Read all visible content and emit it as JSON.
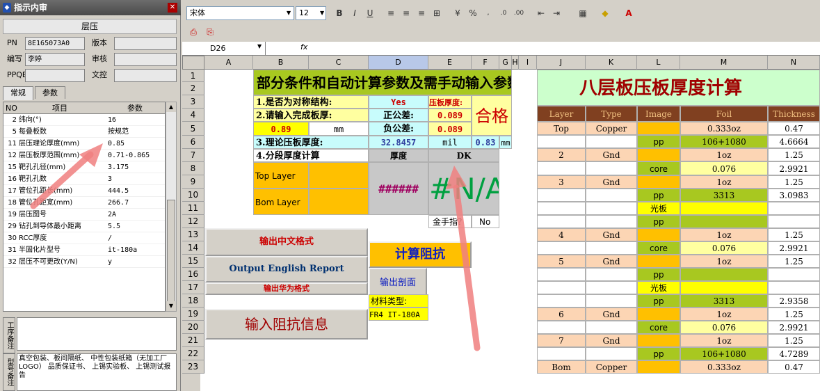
{
  "panel": {
    "title": "指示内审",
    "section": "层压",
    "fields": [
      {
        "label": "PN",
        "value": "8E165073A0"
      },
      {
        "label": "版本",
        "value": ""
      },
      {
        "label": "编写",
        "value": "李婷"
      },
      {
        "label": "审核",
        "value": ""
      },
      {
        "label": "PPQE",
        "value": ""
      },
      {
        "label": "文控",
        "value": ""
      }
    ],
    "tabs": [
      "常规",
      "参数"
    ],
    "grid_headers": [
      "NO",
      "项目",
      "参数"
    ],
    "rows": [
      [
        "2",
        "纬向(°)",
        "16"
      ],
      [
        "5",
        "每叠板数",
        "按规范"
      ],
      [
        "11",
        "层压理论厚度(mm)",
        "0.85"
      ],
      [
        "12",
        "层压板厚范围(mm)",
        "0.71-0.865"
      ],
      [
        "15",
        "靶孔孔径(mm)",
        "3.175"
      ],
      [
        "16",
        "靶孔孔数",
        "3"
      ],
      [
        "17",
        "管位孔距长(mm)",
        "444.5"
      ],
      [
        "18",
        "管位孔距宽(mm)",
        "266.7"
      ],
      [
        "19",
        "层压图号",
        "2A"
      ],
      [
        "29",
        "钻孔到导体最小距离",
        "5.5"
      ],
      [
        "30",
        "RCC厚度",
        "/"
      ],
      [
        "31",
        "半固化片型号",
        "it-180a"
      ],
      [
        "32",
        "层压不可更改(Y/N)",
        "y"
      ]
    ],
    "note1_label": "工序备注",
    "note2_label": "型号备注",
    "note2_text": "真空包装、板间隔纸、 中性包装纸箱（无加工厂LOGO） 品质保证书、 上锡实验板、 上锡测试报告"
  },
  "toolbar": {
    "font": "宋体",
    "size": "12",
    "bold": "B",
    "italic": "I",
    "underline": "U"
  },
  "formula": {
    "cellref": "D26",
    "fx": "fx"
  },
  "sheet": {
    "cols": [
      "A",
      "B",
      "C",
      "D",
      "E",
      "F",
      "G",
      "H",
      "I",
      "J",
      "K",
      "L",
      "M",
      "N"
    ],
    "rows": [
      "1",
      "2",
      "3",
      "4",
      "5",
      "6",
      "7",
      "8",
      "9",
      "10",
      "11",
      "12",
      "13",
      "14",
      "15",
      "16",
      "17",
      "18",
      "19",
      "20",
      "21",
      "22",
      "23"
    ],
    "title": "部分条件和自动计算参数及需手动输入参数",
    "r3a": "1.是否为对称结构:",
    "r3c": "Yes",
    "r3d": "压板厚度:",
    "r4a": "2.请输入完成板厚:",
    "r4c": "正公差:",
    "r4d": "0.089",
    "r5a": "0.89",
    "r5b": "mm",
    "r5c": "负公差:",
    "r5d": "0.089",
    "result": "合格",
    "r6a": "3.理论压板厚度:",
    "r6c": "32.8457",
    "r6d": "mil",
    "r6e": "0.83",
    "r6f": "mm",
    "r7a": "4.分段厚度计算",
    "r7c": "厚度",
    "r7d": "DK",
    "top_layer": "Top Layer",
    "bom_layer": "Bom Layer",
    "hash": "######",
    "na": "#N/A",
    "btn_cn": "输出中文格式",
    "btn_en": "Output English Report",
    "btn_hw": "输出华为格式",
    "btn_imp": "输入阻抗信息",
    "gold_label": "金手指？",
    "gold_val": "No",
    "btn_calc": "计算阻抗",
    "btn_sec": "输出剖面",
    "mat_label": "材料类型:",
    "mat_val": "FR4 IT-180A",
    "right_title": "八层板压板厚度计算",
    "stack_headers": [
      "Layer",
      "Type",
      "Image",
      "Foil",
      "Thickness"
    ],
    "stack": [
      [
        "Top",
        "Copper",
        "",
        "0.333oz",
        "0.47"
      ],
      [
        "",
        "",
        "pp",
        "106+1080",
        "4.6664"
      ],
      [
        "2",
        "Gnd",
        "",
        "1oz",
        "1.25"
      ],
      [
        "",
        "",
        "core",
        "0.076",
        "2.9921"
      ],
      [
        "3",
        "Gnd",
        "",
        "1oz",
        "1.25"
      ],
      [
        "",
        "",
        "pp",
        "3313",
        "3.0983"
      ],
      [
        "",
        "",
        "光板",
        "",
        ""
      ],
      [
        "",
        "",
        "pp",
        "",
        ""
      ],
      [
        "4",
        "Gnd",
        "",
        "1oz",
        "1.25"
      ],
      [
        "",
        "",
        "core",
        "0.076",
        "2.9921"
      ],
      [
        "5",
        "Gnd",
        "",
        "1oz",
        "1.25"
      ],
      [
        "",
        "",
        "pp",
        "",
        ""
      ],
      [
        "",
        "",
        "光板",
        "",
        ""
      ],
      [
        "",
        "",
        "pp",
        "3313",
        "2.9358"
      ],
      [
        "6",
        "Gnd",
        "",
        "1oz",
        "1.25"
      ],
      [
        "",
        "",
        "core",
        "0.076",
        "2.9921"
      ],
      [
        "7",
        "Gnd",
        "",
        "1oz",
        "1.25"
      ],
      [
        "",
        "",
        "pp",
        "106+1080",
        "4.7289"
      ],
      [
        "Bom",
        "Copper",
        "",
        "0.333oz",
        "0.47"
      ]
    ]
  }
}
